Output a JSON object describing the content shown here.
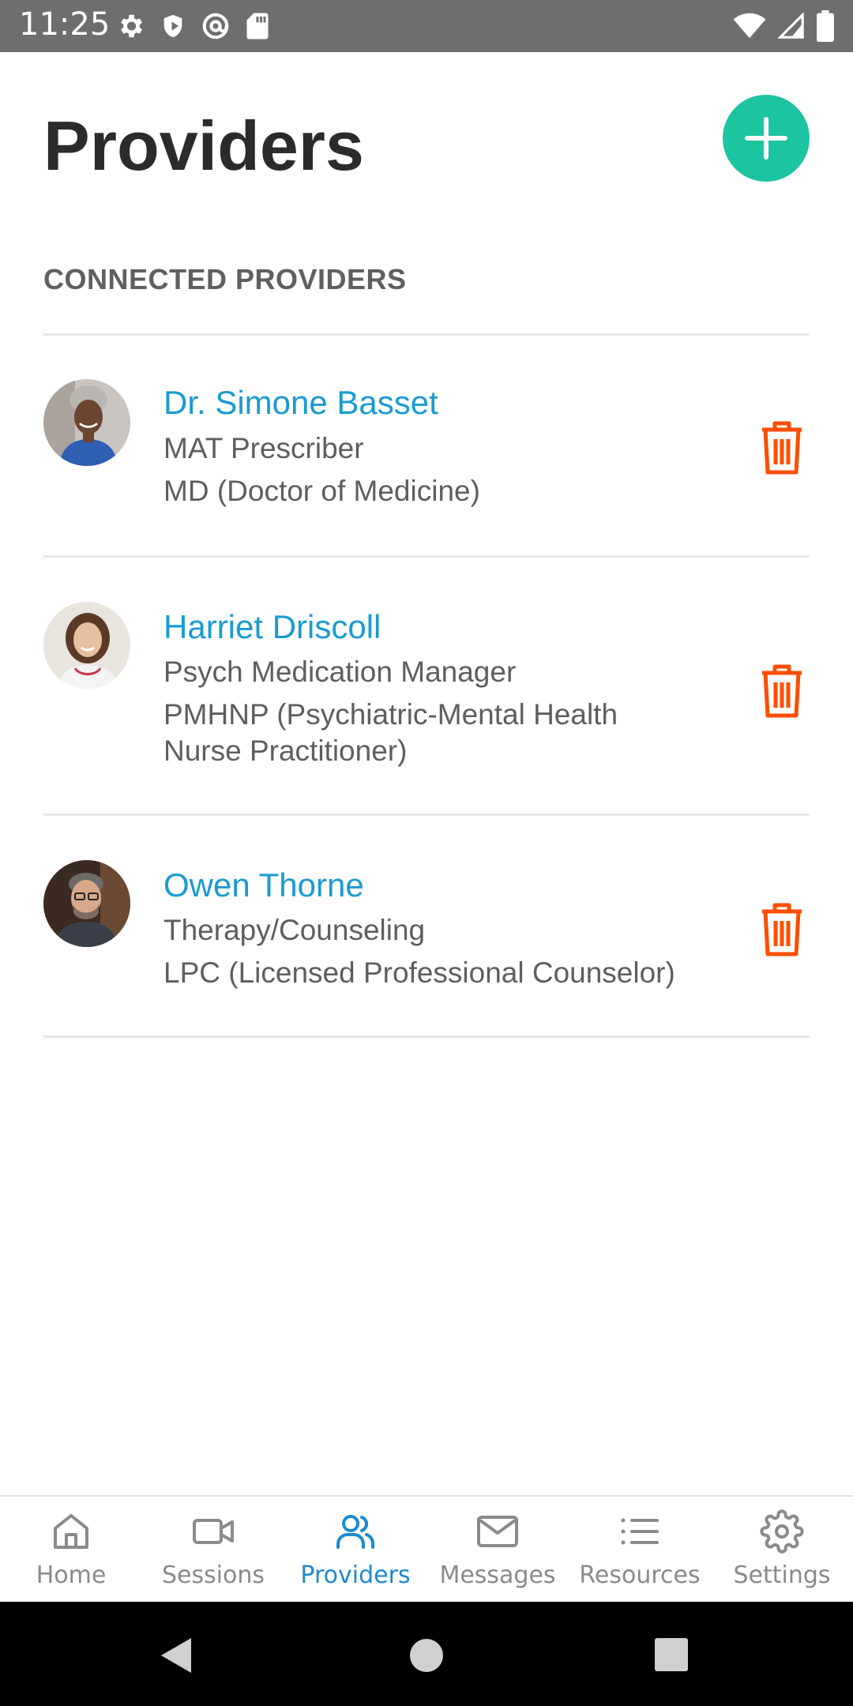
{
  "status_bar": {
    "time": "11:25"
  },
  "header": {
    "title": "Providers",
    "add_icon": "plus-icon"
  },
  "section": {
    "heading": "CONNECTED PROVIDERS"
  },
  "providers": [
    {
      "name": "Dr. Simone Basset",
      "role": "MAT Prescriber",
      "credential": "MD (Doctor of Medicine)"
    },
    {
      "name": "Harriet Driscoll",
      "role": "Psych Medication Manager",
      "credential": "PMHNP (Psychiatric-Mental Health Nurse Practitioner)"
    },
    {
      "name": "Owen Thorne",
      "role": "Therapy/Counseling",
      "credential": "LPC (Licensed Professional Counselor)"
    }
  ],
  "nav": {
    "items": [
      {
        "label": "Home",
        "icon": "home-icon"
      },
      {
        "label": "Sessions",
        "icon": "video-icon"
      },
      {
        "label": "Providers",
        "icon": "users-icon",
        "active": true
      },
      {
        "label": "Messages",
        "icon": "mail-icon"
      },
      {
        "label": "Resources",
        "icon": "list-icon"
      },
      {
        "label": "Settings",
        "icon": "gear-icon"
      }
    ]
  },
  "colors": {
    "accent": "#1cc4a0",
    "link": "#1a9bd0",
    "delete": "#ff4d00",
    "nav_active": "#1a8ad0",
    "nav_inactive": "#8a8a8a"
  }
}
